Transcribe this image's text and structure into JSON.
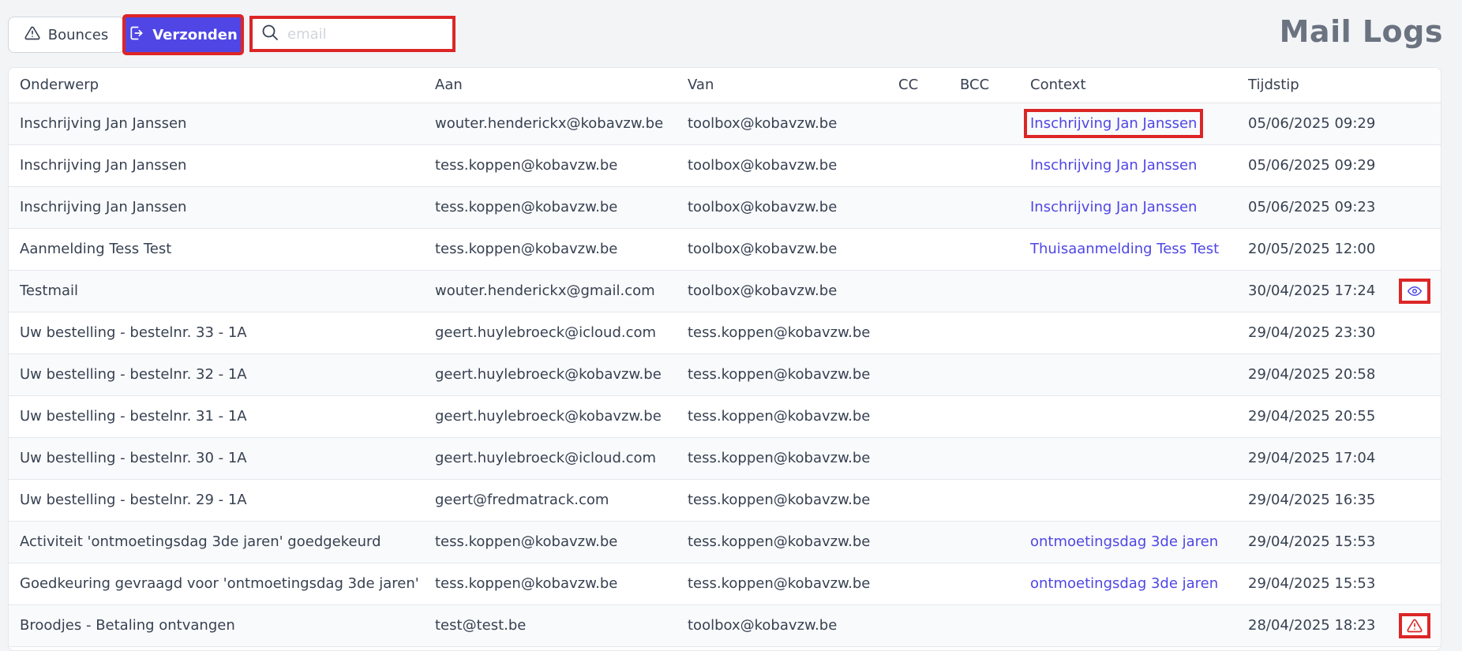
{
  "header": {
    "title": "Mail Logs",
    "tabs": [
      {
        "label": "Bounces",
        "icon": "warning-icon"
      },
      {
        "label": "Verzonden",
        "icon": "send-icon"
      }
    ],
    "search": {
      "placeholder": "email",
      "value": ""
    }
  },
  "colors": {
    "accent": "#4f46e5",
    "highlight": "#dc2626",
    "warning": "#dc2626"
  },
  "table": {
    "columns": [
      "Onderwerp",
      "Aan",
      "Van",
      "CC",
      "BCC",
      "Context",
      "Tijdstip",
      ""
    ],
    "rows": [
      {
        "subject": "Inschrijving Jan Janssen",
        "to": "wouter.henderickx@kobavzw.be",
        "from": "toolbox@kobavzw.be",
        "cc": "",
        "bcc": "",
        "context": "Inschrijving Jan Janssen",
        "time": "05/06/2025 09:29",
        "action": ""
      },
      {
        "subject": "Inschrijving Jan Janssen",
        "to": "tess.koppen@kobavzw.be",
        "from": "toolbox@kobavzw.be",
        "cc": "",
        "bcc": "",
        "context": "Inschrijving Jan Janssen",
        "time": "05/06/2025 09:29",
        "action": ""
      },
      {
        "subject": "Inschrijving Jan Janssen",
        "to": "tess.koppen@kobavzw.be",
        "from": "toolbox@kobavzw.be",
        "cc": "",
        "bcc": "",
        "context": "Inschrijving Jan Janssen",
        "time": "05/06/2025 09:23",
        "action": ""
      },
      {
        "subject": "Aanmelding Tess Test",
        "to": "tess.koppen@kobavzw.be",
        "from": "toolbox@kobavzw.be",
        "cc": "",
        "bcc": "",
        "context": "Thuisaanmelding Tess Test",
        "time": "20/05/2025 12:00",
        "action": ""
      },
      {
        "subject": "Testmail",
        "to": "wouter.henderickx@gmail.com",
        "from": "toolbox@kobavzw.be",
        "cc": "",
        "bcc": "",
        "context": "",
        "time": "30/04/2025 17:24",
        "action": "eye-icon"
      },
      {
        "subject": "Uw bestelling - bestelnr. 33 - 1A",
        "to": "geert.huylebroeck@icloud.com",
        "from": "tess.koppen@kobavzw.be",
        "cc": "",
        "bcc": "",
        "context": "",
        "time": "29/04/2025 23:30",
        "action": ""
      },
      {
        "subject": "Uw bestelling - bestelnr. 32 - 1A",
        "to": "geert.huylebroeck@kobavzw.be",
        "from": "tess.koppen@kobavzw.be",
        "cc": "",
        "bcc": "",
        "context": "",
        "time": "29/04/2025 20:58",
        "action": ""
      },
      {
        "subject": "Uw bestelling - bestelnr. 31 - 1A",
        "to": "geert.huylebroeck@kobavzw.be",
        "from": "tess.koppen@kobavzw.be",
        "cc": "",
        "bcc": "",
        "context": "",
        "time": "29/04/2025 20:55",
        "action": ""
      },
      {
        "subject": "Uw bestelling - bestelnr. 30 - 1A",
        "to": "geert.huylebroeck@icloud.com",
        "from": "tess.koppen@kobavzw.be",
        "cc": "",
        "bcc": "",
        "context": "",
        "time": "29/04/2025 17:04",
        "action": ""
      },
      {
        "subject": "Uw bestelling - bestelnr. 29 - 1A",
        "to": "geert@fredmatrack.com",
        "from": "tess.koppen@kobavzw.be",
        "cc": "",
        "bcc": "",
        "context": "",
        "time": "29/04/2025 16:35",
        "action": ""
      },
      {
        "subject": "Activiteit 'ontmoetingsdag 3de jaren' goedgekeurd",
        "to": "tess.koppen@kobavzw.be",
        "from": "tess.koppen@kobavzw.be",
        "cc": "",
        "bcc": "",
        "context": "ontmoetingsdag 3de jaren",
        "time": "29/04/2025 15:53",
        "action": ""
      },
      {
        "subject": "Goedkeuring gevraagd voor 'ontmoetingsdag 3de jaren'",
        "to": "tess.koppen@kobavzw.be",
        "from": "tess.koppen@kobavzw.be",
        "cc": "",
        "bcc": "",
        "context": "ontmoetingsdag 3de jaren",
        "time": "29/04/2025 15:53",
        "action": ""
      },
      {
        "subject": "Broodjes - Betaling ontvangen",
        "to": "test@test.be",
        "from": "toolbox@kobavzw.be",
        "cc": "",
        "bcc": "",
        "context": "",
        "time": "28/04/2025 18:23",
        "action": "warning-icon"
      }
    ]
  }
}
